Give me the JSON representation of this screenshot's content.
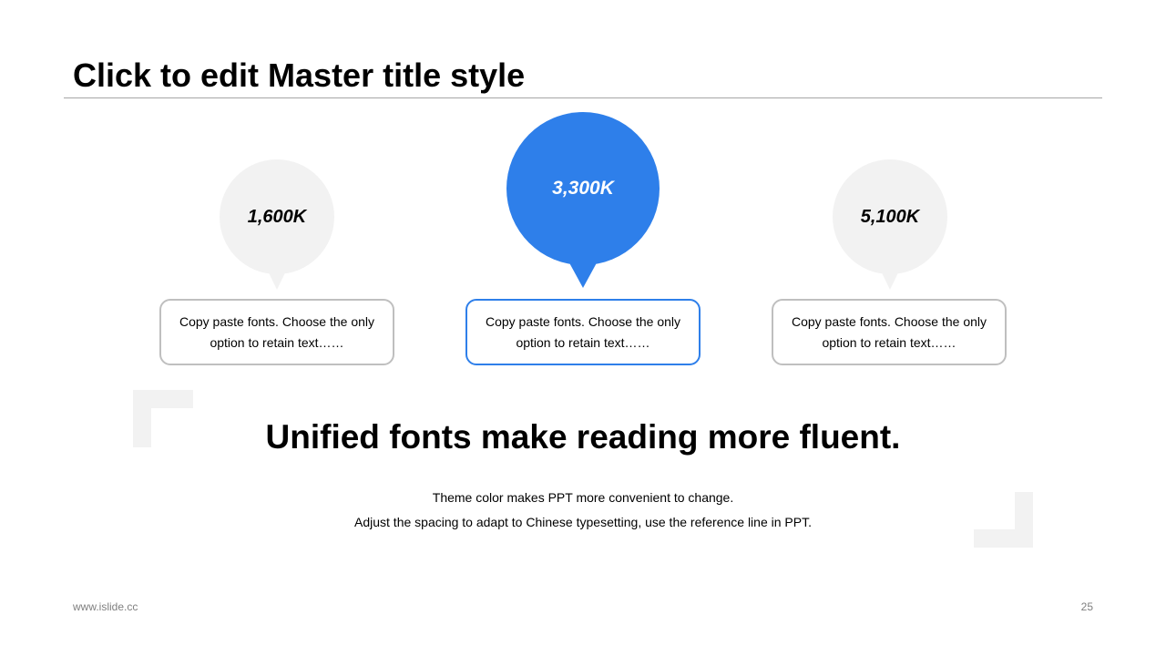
{
  "slide": {
    "title": "Click to edit Master title style",
    "bubbles": [
      {
        "value": "1,600K",
        "highlighted": false,
        "color": "#f2f2f2"
      },
      {
        "value": "3,300K",
        "highlighted": true,
        "color": "#2e7fea"
      },
      {
        "value": "5,100K",
        "highlighted": false,
        "color": "#f2f2f2"
      }
    ],
    "cards": [
      {
        "text": "Copy paste fonts. Choose the only option to retain text……",
        "highlighted": false
      },
      {
        "text": "Copy paste fonts. Choose the only option to retain text……",
        "highlighted": true
      },
      {
        "text": "Copy paste fonts. Choose the only option to retain text……",
        "highlighted": false
      }
    ],
    "headline": "Unified fonts make reading more fluent.",
    "description_lines": [
      "Theme color makes PPT more convenient to change.",
      "Adjust the spacing to adapt to Chinese typesetting, use the reference line in PPT."
    ]
  },
  "footer": {
    "url": "www.islide.cc",
    "page_number": "25"
  },
  "colors": {
    "accent": "#2e7fea",
    "bubble_gray": "#f2f2f2",
    "card_border": "#bfbfbf",
    "rule": "#a6a6a6"
  }
}
